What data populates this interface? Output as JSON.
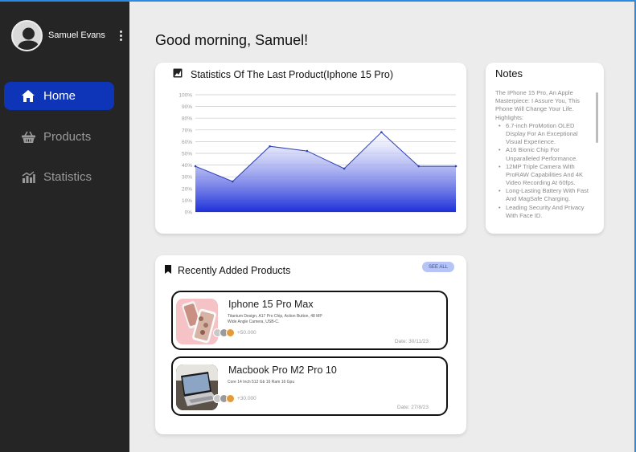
{
  "profile": {
    "name": "Samuel Evans"
  },
  "nav": [
    {
      "label": "Home",
      "icon": "home-icon",
      "active": true
    },
    {
      "label": "Products",
      "icon": "basket-icon",
      "active": false
    },
    {
      "label": "Statistics",
      "icon": "bar-chart-icon",
      "active": false
    }
  ],
  "greeting": "Good morning, Samuel!",
  "stats": {
    "title": "Statistics Of The Last Product(Iphone 15 Pro)"
  },
  "chart_data": {
    "type": "area",
    "title": "Statistics Of The Last Product(Iphone 15 Pro)",
    "y_tick_labels": [
      "0%",
      "10%",
      "20%",
      "30%",
      "40%",
      "50%",
      "60%",
      "70%",
      "80%",
      "90%",
      "100%"
    ],
    "ylim": [
      0,
      100
    ],
    "x": [
      0,
      1,
      2,
      3,
      4,
      5,
      6,
      7
    ],
    "values": [
      39,
      26,
      56,
      52,
      37,
      68,
      39,
      39
    ],
    "x_labels_shown": false,
    "grid": true,
    "line_color": "#2f41b7",
    "fill_gradient": [
      "#ffffff",
      "#1d2fd9"
    ]
  },
  "notes": {
    "title": "Notes",
    "intro": "The IPhone 15 Pro, An Apple Masterpiece: I Assure You, This Phone Will Change Your Life. Highlights:",
    "items": [
      "6.7-inch ProMotion OLED Display For An Exceptional Visual Experience.",
      "A16 Bionic Chip For Unparalleled Performance.",
      "12MP Triple Camera With ProRAW Capabilities And 4K Video Recording At 60fps.",
      "Long-Lasting Battery With Fast And MagSafe Charging.",
      "Leading Security And Privacy With Face ID."
    ]
  },
  "recent": {
    "title": "Recently Added Products",
    "see_all": "SEE ALL",
    "products": [
      {
        "name": "Iphone 15 Pro Max",
        "desc": "Titanium Design, A17 Pro Chip, Action Button, 48 MP Wide Angle Camera, USB-C.",
        "views": "+50.000",
        "date": "Date: 30/11/23"
      },
      {
        "name": "Macbook Pro M2 Pro 10",
        "desc": "Core 14 Inch 512 Gb 16 Ram 16 Gpu",
        "views": "+30.000",
        "date": "Date: 27/8/23"
      }
    ]
  },
  "colors": {
    "sidebar_bg": "#252525",
    "accent": "#0e34b8",
    "page_bg": "#ececec",
    "see_all_bg": "#b7c4f6"
  }
}
